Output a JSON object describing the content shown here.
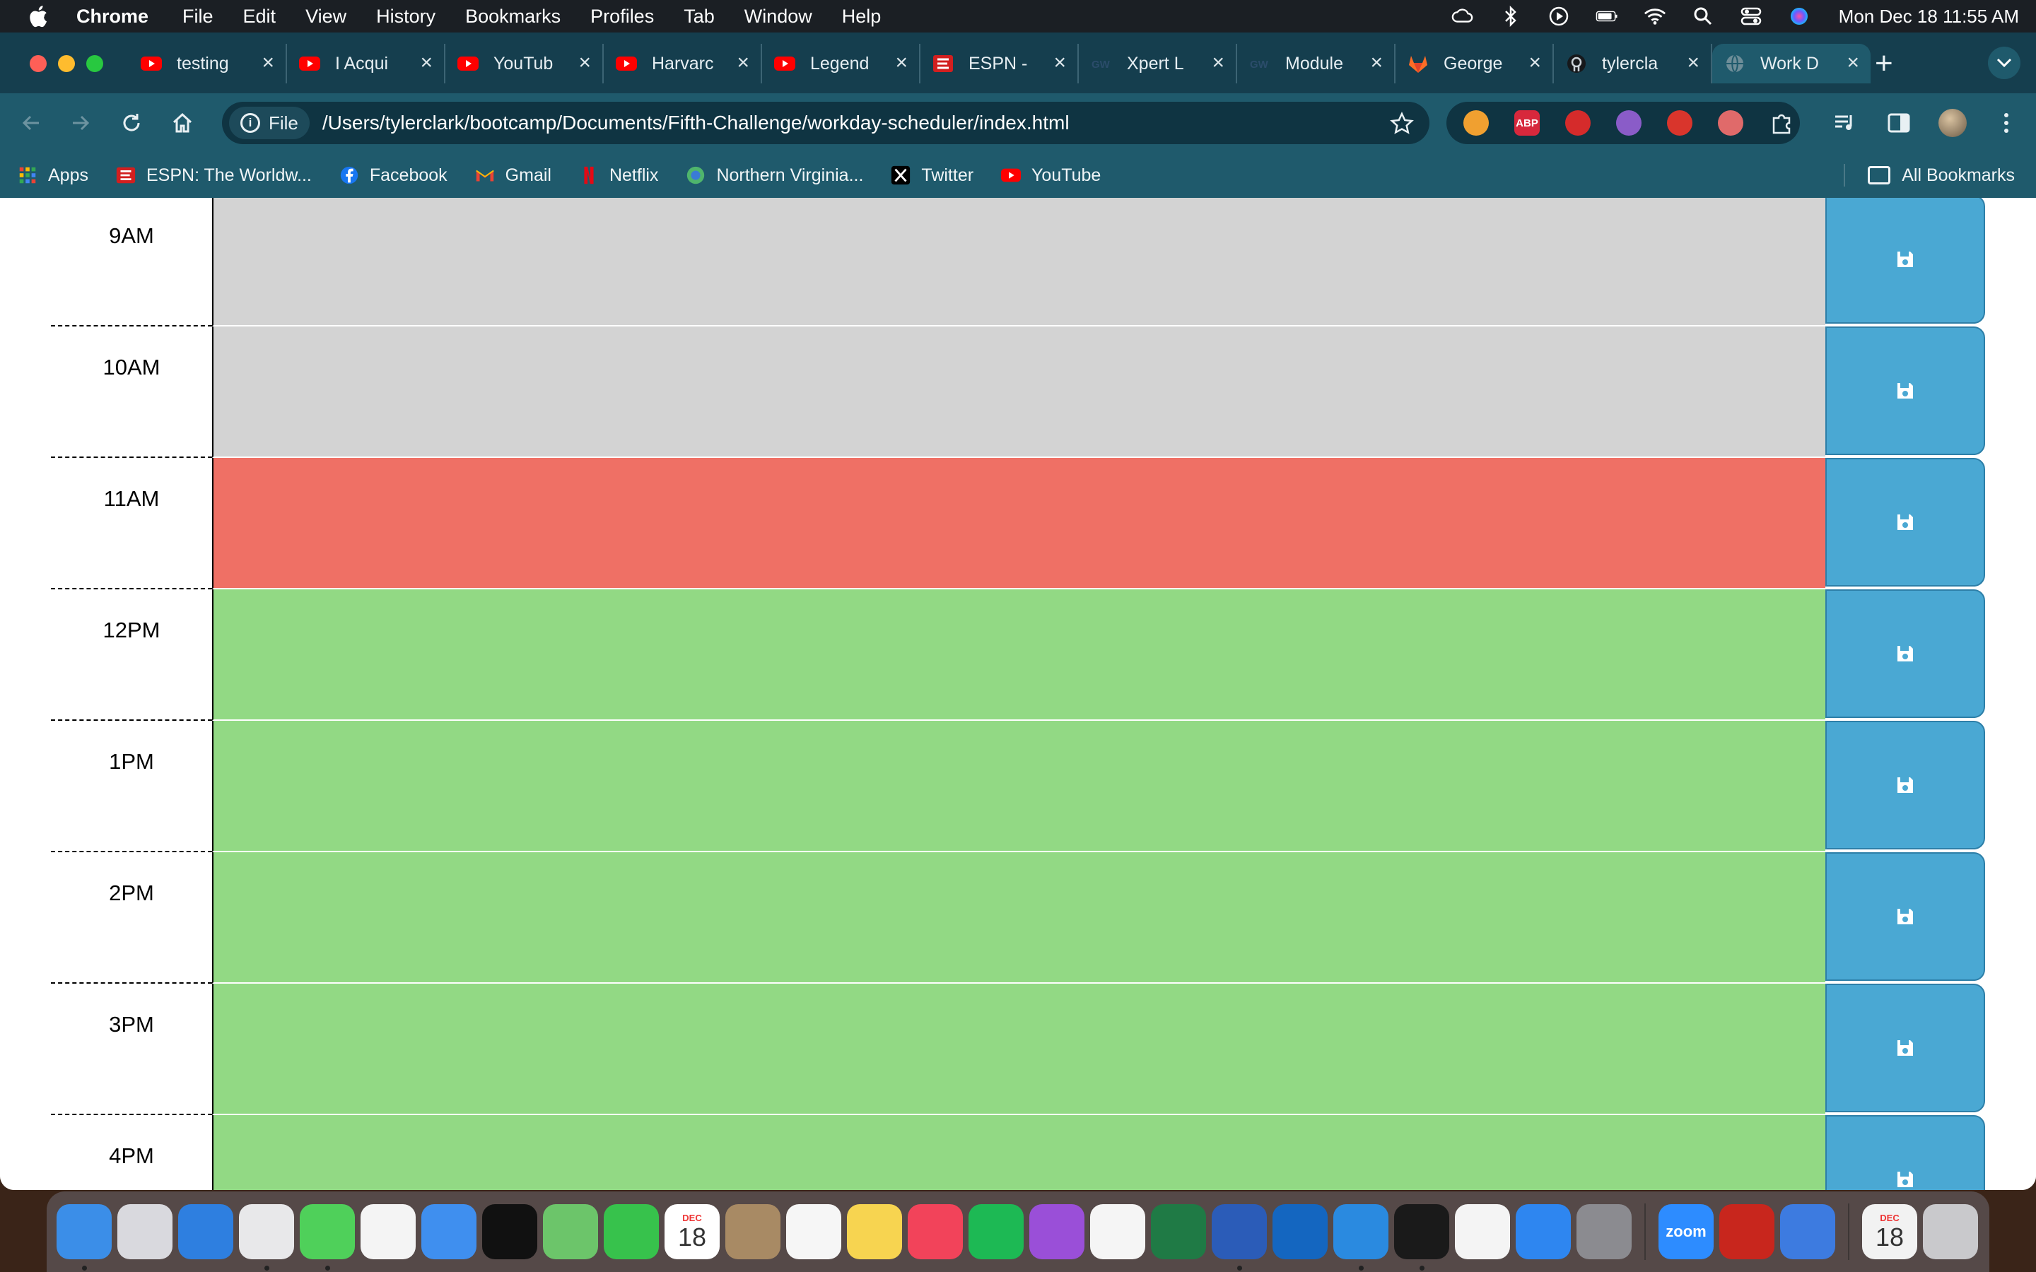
{
  "menubar": {
    "app_name": "Chrome",
    "items": [
      "File",
      "Edit",
      "View",
      "History",
      "Bookmarks",
      "Profiles",
      "Tab",
      "Window",
      "Help"
    ],
    "clock": "Mon Dec 18  11:55 AM",
    "status_icons": [
      "creative-cloud-icon",
      "bluetooth-icon",
      "now-playing-icon",
      "battery-icon",
      "wifi-icon",
      "spotlight-search-icon",
      "control-center-icon",
      "siri-icon"
    ]
  },
  "tabs": [
    {
      "title": "testing",
      "favicon": "youtube-icon",
      "active": false
    },
    {
      "title": "I Acqui",
      "favicon": "youtube-icon",
      "active": false
    },
    {
      "title": "YouTub",
      "favicon": "youtube-icon",
      "active": false
    },
    {
      "title": "Harvarc",
      "favicon": "youtube-icon",
      "active": false
    },
    {
      "title": "Legend",
      "favicon": "youtube-icon",
      "active": false
    },
    {
      "title": "ESPN -",
      "favicon": "espn-icon",
      "active": false
    },
    {
      "title": "Xpert L",
      "favicon": "gw-icon",
      "active": false
    },
    {
      "title": "Module",
      "favicon": "gw-icon",
      "active": false
    },
    {
      "title": "George",
      "favicon": "gitlab-icon",
      "active": false
    },
    {
      "title": "tylercla",
      "favicon": "github-icon",
      "active": false
    },
    {
      "title": "Work D",
      "favicon": "globe-icon",
      "active": true
    }
  ],
  "omnibox": {
    "chip_label": "File",
    "url": "/Users/tylerclark/bootcamp/Documents/Fifth-Challenge/workday-scheduler/index.html"
  },
  "extensions": [
    {
      "name": "sun-extension-icon",
      "color": "#f0a030",
      "label": ""
    },
    {
      "name": "adblock-plus-icon",
      "color": "#d7283c",
      "label": "ABP"
    },
    {
      "name": "red-circle-extension-icon",
      "color": "#d52b2b",
      "label": ""
    },
    {
      "name": "purple-extension-icon",
      "color": "#8a5cc8",
      "label": ""
    },
    {
      "name": "hand-extension-icon",
      "color": "#d9352c",
      "label": ""
    },
    {
      "name": "screencast-extension-icon",
      "color": "#e06a6a",
      "label": ""
    },
    {
      "name": "puzzle-extensions-icon",
      "color": "#1f5a6c",
      "label": ""
    }
  ],
  "bookmarks": {
    "items": [
      {
        "label": "Apps",
        "icon": "apps-grid-icon"
      },
      {
        "label": "ESPN: The Worldw...",
        "icon": "espn-icon"
      },
      {
        "label": "Facebook",
        "icon": "facebook-icon"
      },
      {
        "label": "Gmail",
        "icon": "gmail-icon"
      },
      {
        "label": "Netflix",
        "icon": "netflix-icon"
      },
      {
        "label": "Northern Virginia...",
        "icon": "nova-icon"
      },
      {
        "label": "Twitter",
        "icon": "x-twitter-icon"
      },
      {
        "label": "YouTube",
        "icon": "youtube-icon"
      }
    ],
    "all_label": "All Bookmarks"
  },
  "scheduler": {
    "colors": {
      "past": "#d3d3d3",
      "present": "#ef7065",
      "future": "#92d984",
      "save": "#4aa8d3"
    },
    "rows": [
      {
        "hour": "9AM",
        "state": "past",
        "text": ""
      },
      {
        "hour": "10AM",
        "state": "past",
        "text": ""
      },
      {
        "hour": "11AM",
        "state": "present",
        "text": ""
      },
      {
        "hour": "12PM",
        "state": "future",
        "text": ""
      },
      {
        "hour": "1PM",
        "state": "future",
        "text": ""
      },
      {
        "hour": "2PM",
        "state": "future",
        "text": ""
      },
      {
        "hour": "3PM",
        "state": "future",
        "text": ""
      },
      {
        "hour": "4PM",
        "state": "future",
        "text": ""
      }
    ]
  },
  "dock": {
    "apps": [
      {
        "name": "finder",
        "color": "#3b8ee8",
        "running": true
      },
      {
        "name": "launchpad",
        "color": "#d9d9de",
        "running": false
      },
      {
        "name": "safari",
        "color": "#2e7fe0",
        "running": false
      },
      {
        "name": "chrome",
        "color": "#e8e8ea",
        "running": true
      },
      {
        "name": "messages",
        "color": "#4fd05a",
        "running": true
      },
      {
        "name": "photos",
        "color": "#f4f4f4",
        "running": false
      },
      {
        "name": "mail",
        "color": "#3f8fef",
        "running": false
      },
      {
        "name": "apple-tv",
        "color": "#111111",
        "running": false
      },
      {
        "name": "maps",
        "color": "#6cc56a",
        "running": false
      },
      {
        "name": "facetime",
        "color": "#37c24c",
        "running": false
      },
      {
        "name": "calendar",
        "color": "#ffffff",
        "running": false
      },
      {
        "name": "contacts",
        "color": "#a88a64",
        "running": false
      },
      {
        "name": "reminders",
        "color": "#f6f6f6",
        "running": false
      },
      {
        "name": "notes",
        "color": "#f7d450",
        "running": false
      },
      {
        "name": "music",
        "color": "#f2435a",
        "running": false
      },
      {
        "name": "spotify",
        "color": "#1db954",
        "running": false
      },
      {
        "name": "podcasts",
        "color": "#9a4fd8",
        "running": false
      },
      {
        "name": "news",
        "color": "#f5f5f5",
        "running": false
      },
      {
        "name": "excel",
        "color": "#1f7a45",
        "running": false
      },
      {
        "name": "word",
        "color": "#2b5cb8",
        "running": true
      },
      {
        "name": "outlook",
        "color": "#1466c0",
        "running": false
      },
      {
        "name": "vscode",
        "color": "#2a8ae0",
        "running": true
      },
      {
        "name": "terminal",
        "color": "#1a1a1a",
        "running": true
      },
      {
        "name": "slack",
        "color": "#f4f4f4",
        "running": false
      },
      {
        "name": "app-store",
        "color": "#2e86f0",
        "running": false
      },
      {
        "name": "system-settings",
        "color": "#8b8b90",
        "running": false
      },
      {
        "name": "zoom",
        "color": "#2d8cff",
        "running": false
      },
      {
        "name": "acrobat",
        "color": "#c8261d",
        "running": false
      },
      {
        "name": "xcode",
        "color": "#3d7be0",
        "running": false
      },
      {
        "name": "calendar-doc",
        "color": "#f2f2f2",
        "running": false
      },
      {
        "name": "trash",
        "color": "#c9c9cc",
        "running": false
      }
    ],
    "zoom_label": "zoom",
    "calendar_month": "DEC",
    "calendar_day": "18"
  }
}
